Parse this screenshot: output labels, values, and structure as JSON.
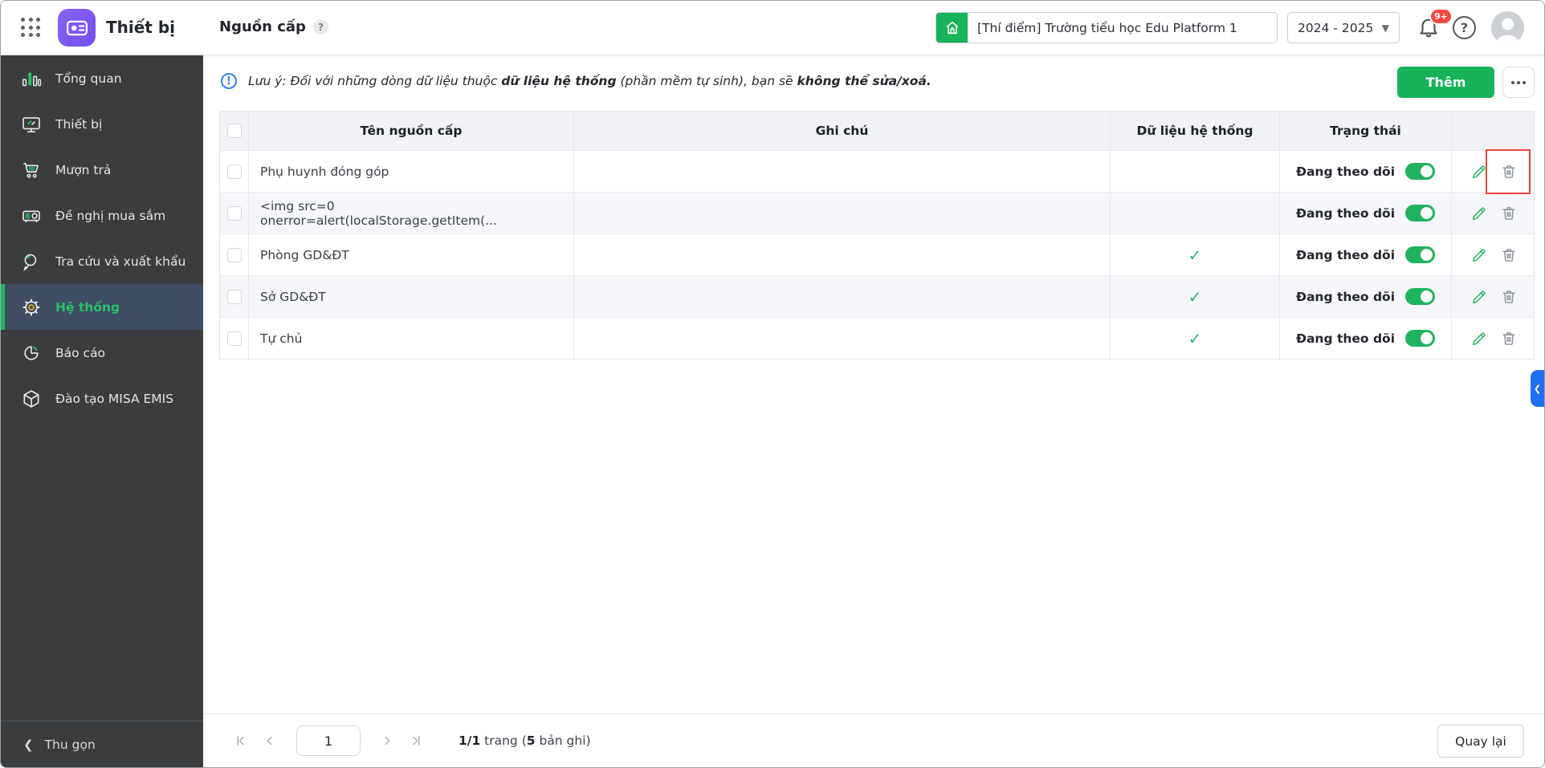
{
  "header": {
    "app_title": "Thiết bị",
    "page_title": "Nguồn cấp",
    "page_help_badge": "?",
    "school_name": "[Thí điểm] Trường tiểu học Edu Platform 1",
    "school_year": "2024 - 2025",
    "notification_count": "9+",
    "help_label": "?"
  },
  "sidebar": {
    "items": [
      {
        "label": "Tổng quan",
        "icon": "bar-chart-icon"
      },
      {
        "label": "Thiết bị",
        "icon": "monitor-icon"
      },
      {
        "label": "Mượn trả",
        "icon": "cart-icon"
      },
      {
        "label": "Đề nghị mua sắm",
        "icon": "projector-icon"
      },
      {
        "label": "Tra cứu và xuất khẩu",
        "icon": "search-icon"
      },
      {
        "label": "Hệ thống",
        "icon": "gear-icon",
        "active": true
      },
      {
        "label": "Báo cáo",
        "icon": "pie-chart-icon"
      },
      {
        "label": "Đào tạo MISA EMIS",
        "icon": "cube-icon"
      }
    ],
    "collapse_label": "Thu gọn"
  },
  "note": {
    "prefix": "Lưu ý: Đối với những dòng dữ liệu thuộc ",
    "bold1": "dữ liệu hệ thống",
    "mid": " (phần mềm tự sinh), bạn sẽ ",
    "bold2": "không thể sửa/xoá."
  },
  "toolbar": {
    "add_label": "Thêm"
  },
  "table": {
    "columns": {
      "name": "Tên nguồn cấp",
      "note": "Ghi chú",
      "system": "Dữ liệu hệ thống",
      "status": "Trạng thái"
    },
    "rows": [
      {
        "name": "Phụ huynh đóng góp",
        "note": "",
        "system": false,
        "status": "Đang theo dõi",
        "toggle_on": true,
        "highlight_delete": true
      },
      {
        "name": "<img src=0 onerror=alert(localStorage.getItem(...",
        "note": "",
        "system": false,
        "status": "Đang theo dõi",
        "toggle_on": true
      },
      {
        "name": "Phòng GD&ĐT",
        "note": "",
        "system": true,
        "status": "Đang theo dõi",
        "toggle_on": true
      },
      {
        "name": "Sở GD&ĐT",
        "note": "",
        "system": true,
        "status": "Đang theo dõi",
        "toggle_on": true
      },
      {
        "name": "Tự chủ",
        "note": "",
        "system": true,
        "status": "Đang theo dõi",
        "toggle_on": true
      }
    ]
  },
  "pagination": {
    "page": "1",
    "summary_pages": "1/1",
    "summary_mid": " trang (",
    "summary_count": "5",
    "summary_suffix": " bản ghi)"
  },
  "footer": {
    "back_label": "Quay lại"
  },
  "colors": {
    "accent_green": "#17b358",
    "toggle_green": "#1fb35f",
    "annotation_red": "#e5463c",
    "edge_tab_blue": "#1e6ff2",
    "badge_red": "#f5483e",
    "app_icon_purple": "#7c5ef3"
  }
}
